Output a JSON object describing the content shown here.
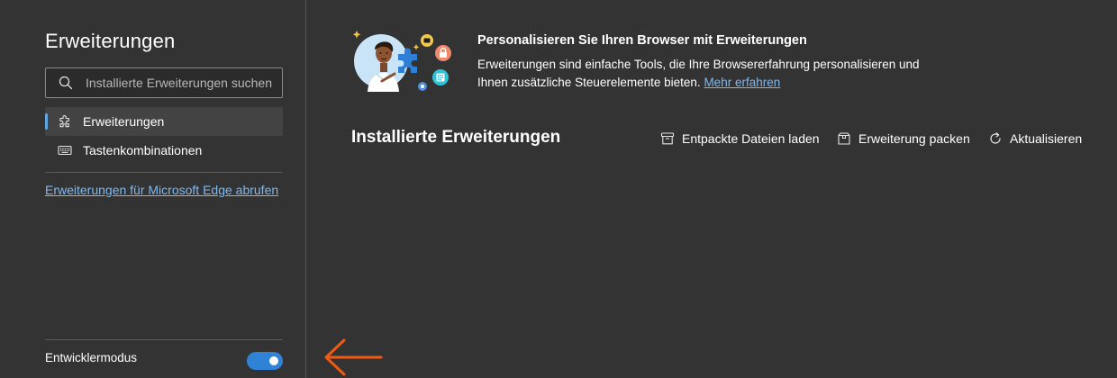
{
  "sidebar": {
    "title": "Erweiterungen",
    "search_placeholder": "Installierte Erweiterungen suchen",
    "nav_items": [
      {
        "label": "Erweiterungen",
        "icon": "puzzle-icon",
        "active": true
      },
      {
        "label": "Tastenkombinationen",
        "icon": "keyboard-icon",
        "active": false
      }
    ],
    "store_link": "Erweiterungen für Microsoft Edge abrufen",
    "developer_mode_label": "Entwicklermodus",
    "developer_mode_on": true
  },
  "hero": {
    "title": "Personalisieren Sie Ihren Browser mit Erweiterungen",
    "description": "Erweiterungen sind einfache Tools, die Ihre Browsererfahrung personalisieren und Ihnen zusätzliche Steuerelemente bieten.",
    "link": "Mehr erfahren"
  },
  "main": {
    "section_title": "Installierte Erweiterungen",
    "actions": [
      {
        "label": "Entpackte Dateien laden",
        "icon": "load-unpacked-icon"
      },
      {
        "label": "Erweiterung packen",
        "icon": "pack-extension-icon"
      },
      {
        "label": "Aktualisieren",
        "icon": "refresh-icon"
      }
    ]
  },
  "colors": {
    "background": "#333333",
    "accent": "#2f82d6",
    "link": "#7cb9f2",
    "annotation_arrow": "#f05a14"
  }
}
